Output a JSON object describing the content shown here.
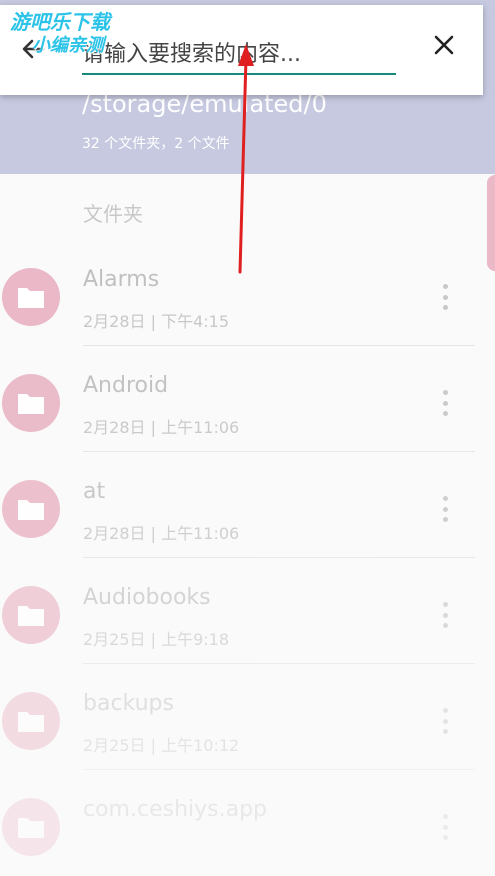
{
  "search": {
    "back_icon": "arrow-left-icon",
    "placeholder": "请输入要搜索的内容...",
    "value": "",
    "close_icon": "close-icon"
  },
  "header": {
    "path": "/storage/emulated/0",
    "summary": "32 个文件夹，2 个文件"
  },
  "watermark": {
    "line1": "游吧乐下载",
    "line2": "小编亲测"
  },
  "section_title": "文件夹",
  "folders": [
    {
      "name": "Alarms",
      "meta": "2月28日 | 下午4:15"
    },
    {
      "name": "Android",
      "meta": "2月28日 | 上午11:06"
    },
    {
      "name": "at",
      "meta": "2月28日 | 上午11:06"
    },
    {
      "name": "Audiobooks",
      "meta": "2月25日 | 上午9:18"
    },
    {
      "name": "backups",
      "meta": "2月25日 | 上午10:12"
    },
    {
      "name": "com.ceshiys.app",
      "meta": ""
    }
  ],
  "colors": {
    "header_bg": "#c6c9e0",
    "accent": "#178a7e",
    "folder_icon_bg": "#eab8c6",
    "arrow": "#e02020"
  }
}
